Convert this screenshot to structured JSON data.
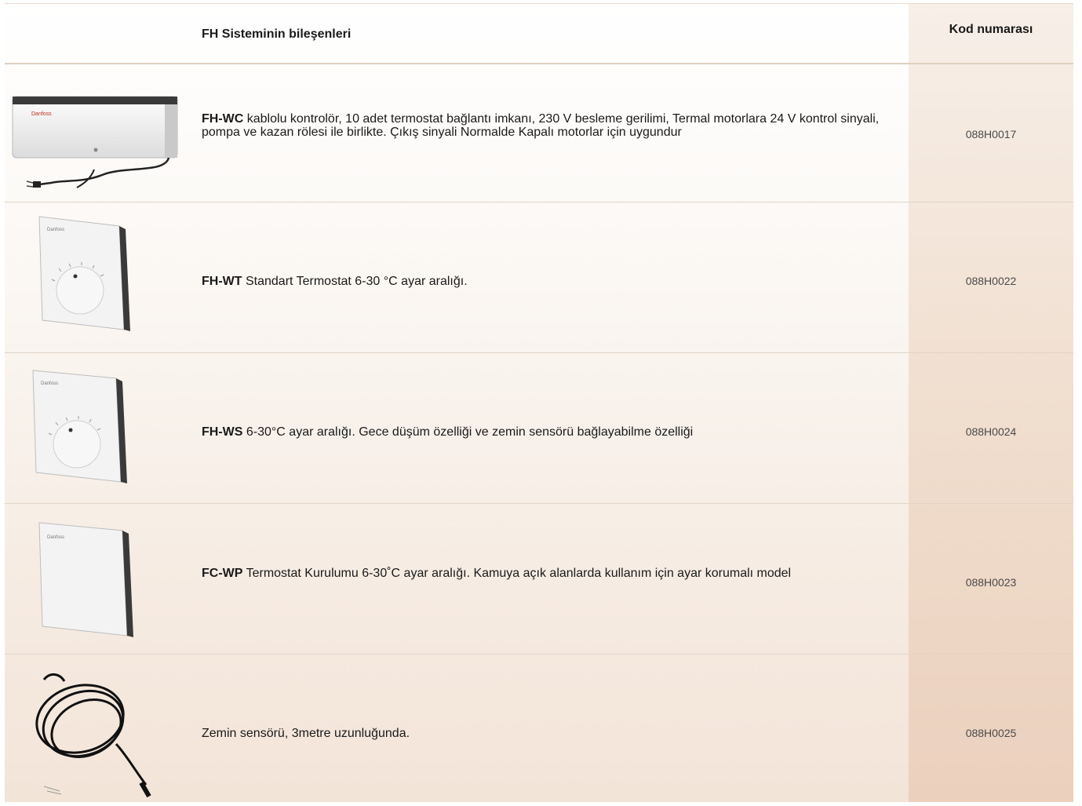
{
  "header": {
    "description_title": "FH Sisteminin  bileşenleri",
    "code_title": "Kod numarası"
  },
  "rows": [
    {
      "model": "FH-WC",
      "text": " kablolu kontrolör, 10 adet termostat bağlantı imkanı, 230 V besleme gerilimi, Termal motorlara 24 V kontrol sinyali, pompa ve kazan rölesi ile birlikte. Çıkış sinyali Normalde Kapalı motorlar için uygundur",
      "code": "088H0017",
      "image": "controller-box"
    },
    {
      "model": "FH-WT",
      "text": " Standart Termostat   6-30 °C ayar aralığı.",
      "code": "088H0022",
      "image": "thermostat-dial"
    },
    {
      "model": "FH-WS",
      "text": " 6-30°C ayar aralığı. Gece düşüm özelliği ve zemin sensörü bağlayabilme özelliği",
      "code": "088H0024",
      "image": "thermostat-dial"
    },
    {
      "model": "FC-WP",
      "text": " Termostat Kurulumu  6-30˚C ayar aralığı. Kamuya açık alanlarda kullanım için ayar korumalı model",
      "code": "088H0023",
      "image": "thermostat-blank"
    },
    {
      "model": "",
      "text": "Zemin sensörü, 3metre uzunluğunda.",
      "code": "088H0025",
      "image": "sensor-cable"
    }
  ]
}
